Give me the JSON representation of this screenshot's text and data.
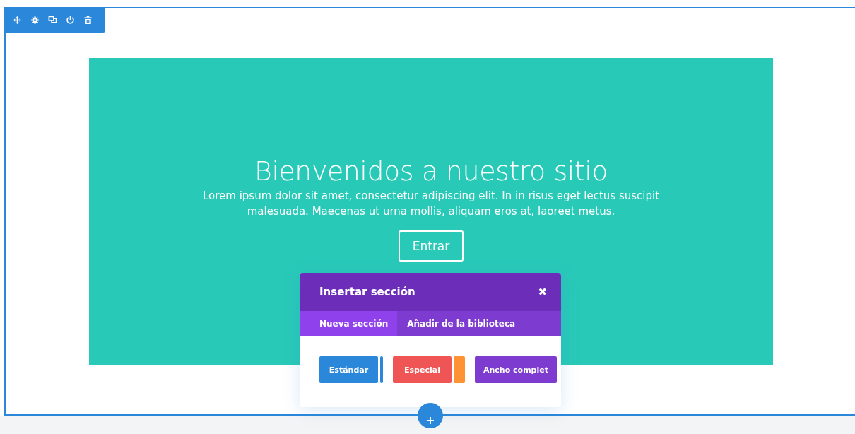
{
  "toolbar": {
    "icons": [
      {
        "kind": "move"
      },
      {
        "kind": "settings"
      },
      {
        "kind": "duplicate"
      },
      {
        "kind": "power"
      },
      {
        "kind": "delete"
      }
    ]
  },
  "hero": {
    "title": "Bienvenidos a nuestro sitio",
    "text": "Lorem ipsum dolor sit amet, consectetur adipiscing elit. In in risus eget lectus suscipit malesuada. Maecenas ut urna mollis, aliquam eros at, laoreet metus.",
    "button": "Entrar"
  },
  "dialog": {
    "title": "Insertar sección",
    "close": "✖",
    "tabs": [
      {
        "label": "Nueva sección",
        "selected": true
      },
      {
        "label": "Añadir de la biblioteca",
        "selected": false
      }
    ],
    "section_types": [
      {
        "kind": "standard",
        "label": "Estándar",
        "color": "#2b87da"
      },
      {
        "kind": "special",
        "label": "Especial",
        "color": "#ef5555"
      },
      {
        "kind": "fullwidth",
        "label": "Ancho complet",
        "color": "#7e3bd0"
      }
    ]
  },
  "add_button": {
    "label": "+"
  }
}
